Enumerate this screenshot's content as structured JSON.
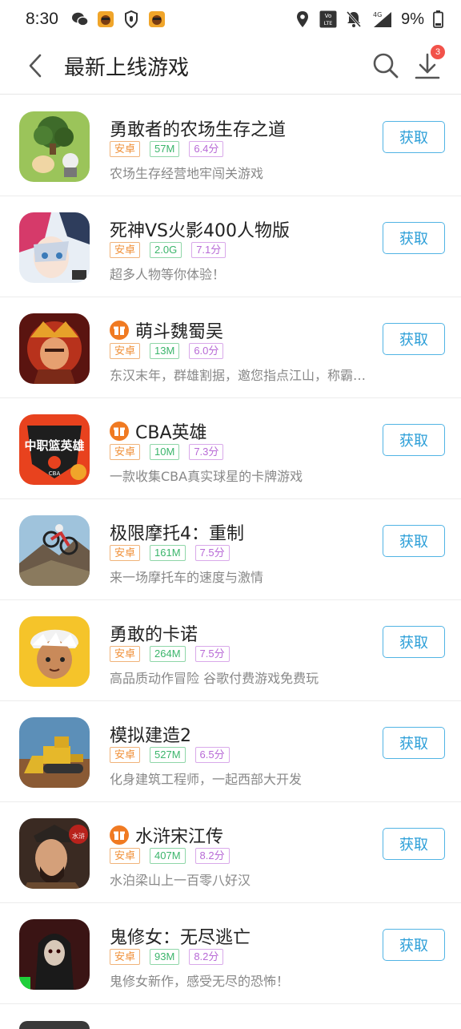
{
  "status_bar": {
    "time": "8:30",
    "battery": "9%",
    "network": "4G",
    "lte_badge": "Vo LTE"
  },
  "header": {
    "title": "最新上线游戏",
    "download_badge": "3",
    "icons": {
      "back": "back-arrow-icon",
      "search": "search-icon",
      "download": "download-icon"
    }
  },
  "colors": {
    "accent": "#2d9fd8",
    "badge": "#f2524a",
    "tag_platform": "#f0913a",
    "tag_size": "#3bb56b",
    "tag_rating": "#b86ad6"
  },
  "games": [
    {
      "name": "勇敢者的农场生存之道",
      "platform": "安卓",
      "size": "57M",
      "rating": "6.4分",
      "desc": "农场生存经营地牢闯关游戏",
      "gift": false,
      "button": "获取"
    },
    {
      "name": "死神VS火影400人物版",
      "platform": "安卓",
      "size": "2.0G",
      "rating": "7.1分",
      "desc": "超多人物等你体验！",
      "gift": false,
      "button": "获取"
    },
    {
      "name": "萌斗魏蜀吴",
      "platform": "安卓",
      "size": "13M",
      "rating": "6.0分",
      "desc": "东汉末年，群雄割据，邀您指点江山，称霸天下",
      "gift": true,
      "button": "获取"
    },
    {
      "name": "CBA英雄",
      "platform": "安卓",
      "size": "10M",
      "rating": "7.3分",
      "desc": "一款收集CBA真实球星的卡牌游戏",
      "gift": true,
      "button": "获取",
      "icon_text": "中职篮英雄",
      "icon_sub": "CBA"
    },
    {
      "name": "极限摩托4：重制",
      "platform": "安卓",
      "size": "161M",
      "rating": "7.5分",
      "desc": "来一场摩托车的速度与激情",
      "gift": false,
      "button": "获取"
    },
    {
      "name": "勇敢的卡诺",
      "platform": "安卓",
      "size": "264M",
      "rating": "7.5分",
      "desc": "高品质动作冒险 谷歌付费游戏免费玩",
      "gift": false,
      "button": "获取"
    },
    {
      "name": "模拟建造2",
      "platform": "安卓",
      "size": "527M",
      "rating": "6.5分",
      "desc": "化身建筑工程师，一起西部大开发",
      "gift": false,
      "button": "获取"
    },
    {
      "name": "水浒宋江传",
      "platform": "安卓",
      "size": "407M",
      "rating": "8.2分",
      "desc": "水泊梁山上一百零八好汉",
      "gift": true,
      "button": "获取",
      "icon_text": "水浒"
    },
    {
      "name": "鬼修女：无尽逃亡",
      "platform": "安卓",
      "size": "93M",
      "rating": "8.2分",
      "desc": "鬼修女新作，感受无尽的恐怖！",
      "gift": false,
      "button": "获取"
    }
  ]
}
